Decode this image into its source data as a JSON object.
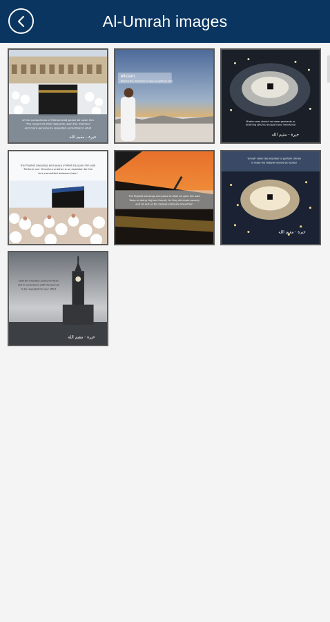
{
  "appbar": {
    "title": "Al-Umrah images",
    "back_icon": "back-arrow-circle-icon",
    "background": "#0a3561"
  },
  "gallery": {
    "images": [
      {
        "subject": "kaaba-courtyard-crowd"
      },
      {
        "subject": "pilgrim-at-sunset",
        "caption_word": "#Islam"
      },
      {
        "subject": "haram-night-aerial"
      },
      {
        "subject": "kaaba-pilgrims-white"
      },
      {
        "subject": "kaaba-roof-orange-sky"
      },
      {
        "subject": "makkah-night-aerial"
      },
      {
        "subject": "clock-tower-grey-sky"
      }
    ]
  }
}
